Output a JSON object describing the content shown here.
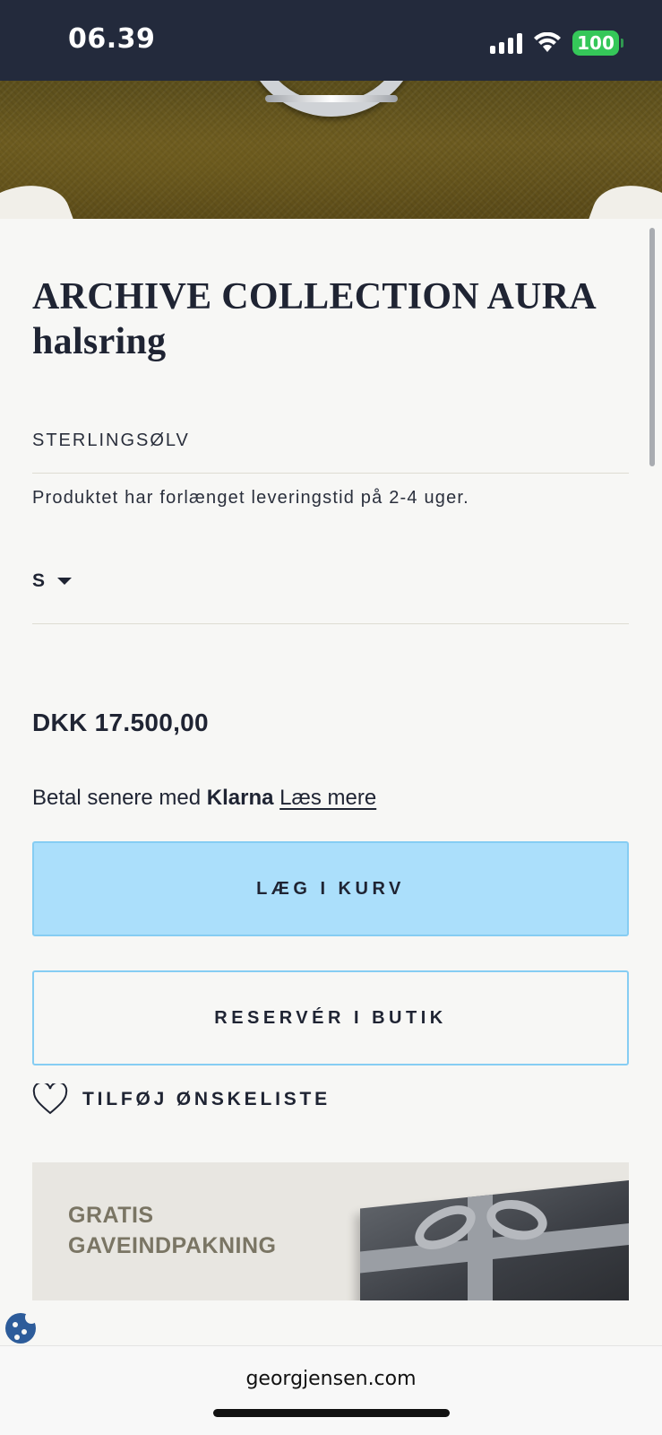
{
  "status_bar": {
    "time": "06.39",
    "battery": "100",
    "icons": [
      "signal-icon",
      "wifi-icon",
      "battery-icon"
    ]
  },
  "product": {
    "title_line1": "ARCHIVE COLLECTION AURA",
    "title_line2": "halsring",
    "material": "STERLINGSØLV",
    "delivery_note": "Produktet har forlænget leveringstid på 2-4 uger.",
    "size_selected": "S",
    "price": "DKK 17.500,00"
  },
  "klarna": {
    "prefix": "Betal senere med ",
    "brand": "Klarna",
    "link": "Læs mere"
  },
  "actions": {
    "add_to_cart": "LÆG I KURV",
    "reserve": "RESERVÉR I BUTIK",
    "wishlist": "TILFØJ ØNSKELISTE"
  },
  "banner": {
    "line1": "GRATIS",
    "line2": "GAVEINDPAKNING"
  },
  "browser": {
    "url": "georgjensen.com"
  },
  "colors": {
    "status_bar_bg": "#232a3c",
    "primary_button": "#abdffb",
    "button_border": "#86cdf3",
    "text": "#1f2433",
    "battery": "#35c759"
  }
}
